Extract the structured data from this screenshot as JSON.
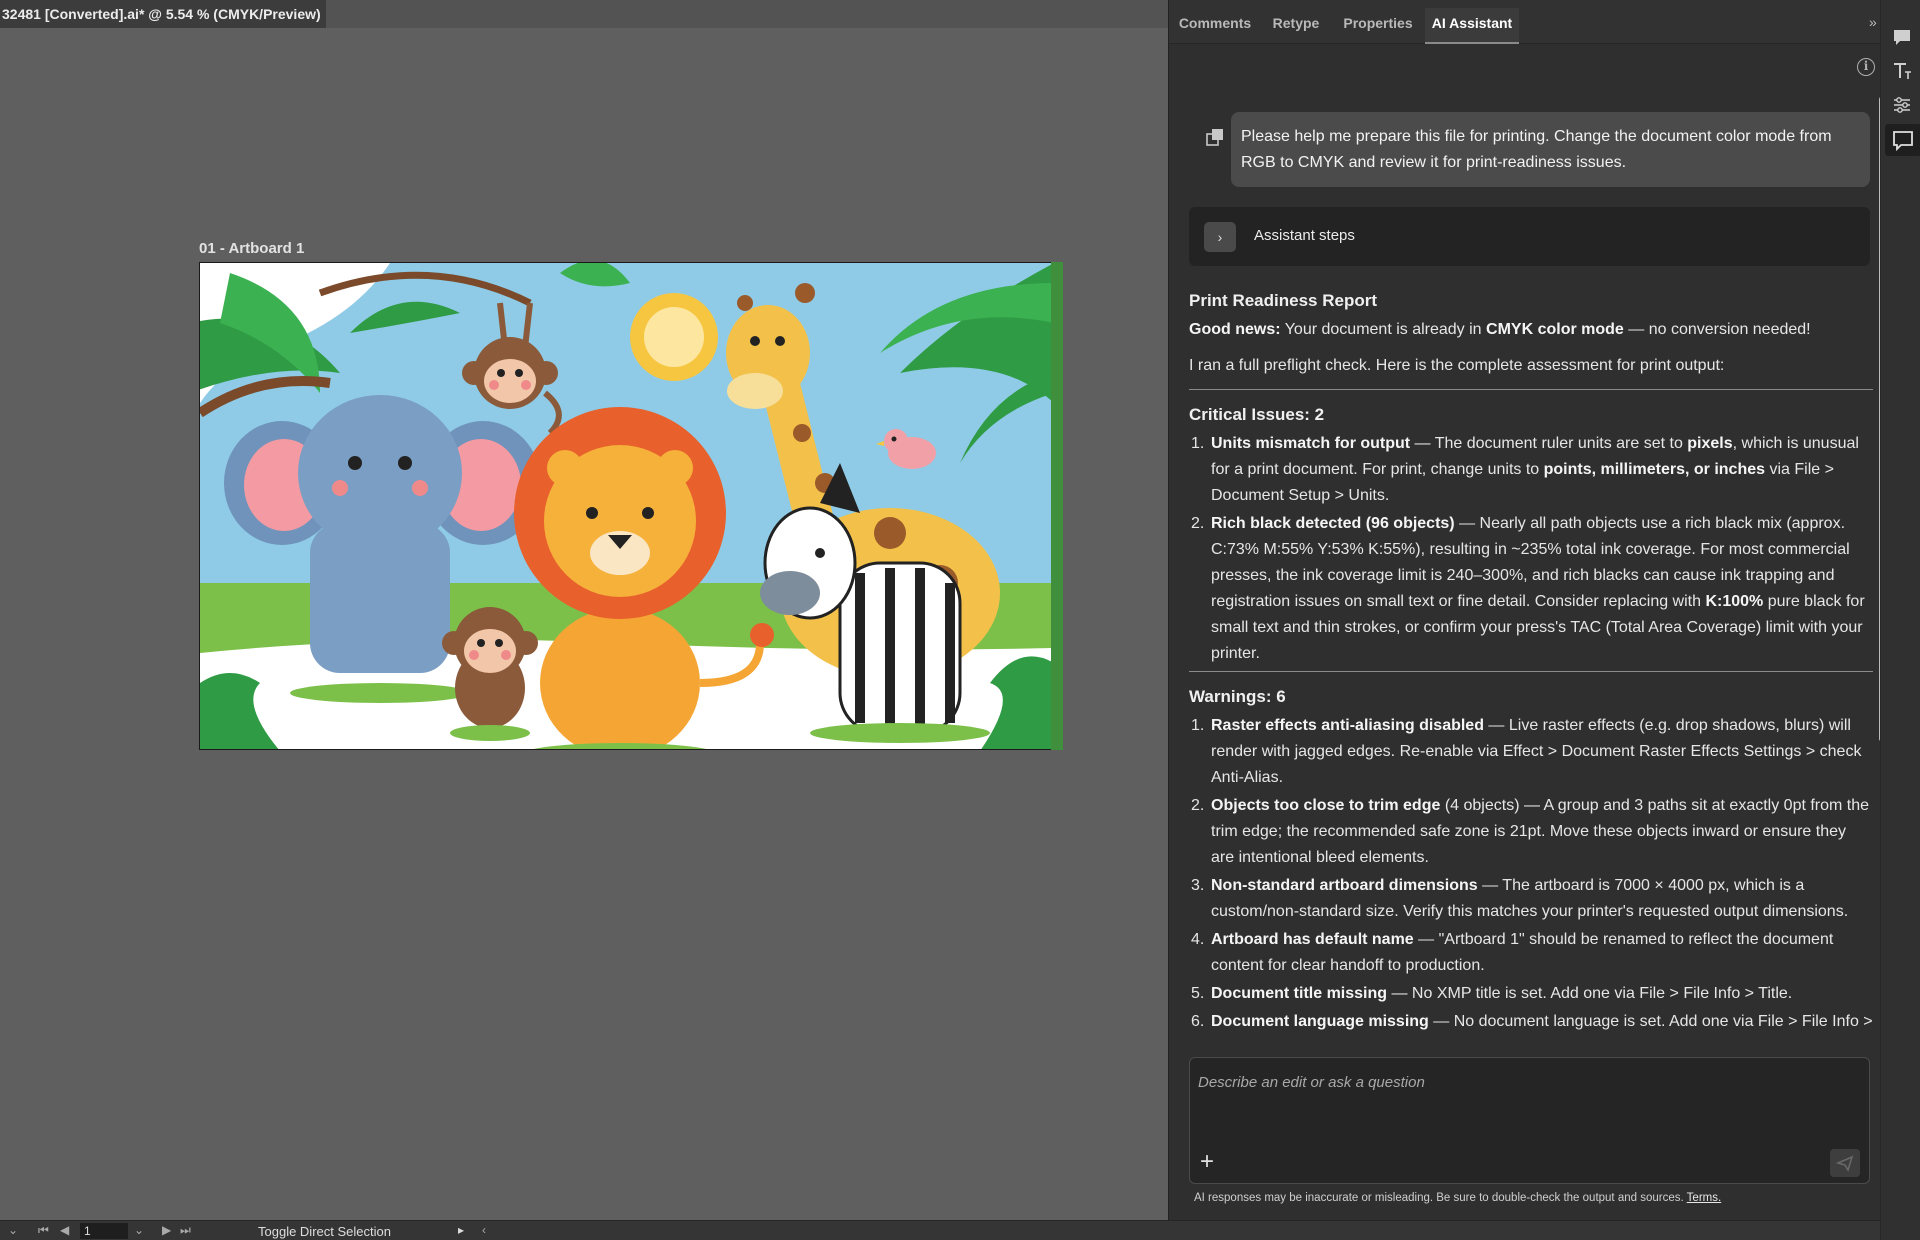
{
  "document": {
    "tab_title": "32481 [Converted].ai* @ 5.54 % (CMYK/Preview)"
  },
  "canvas": {
    "artboard_label": "01 - Artboard 1"
  },
  "panel": {
    "tabs": [
      {
        "label": "Comments"
      },
      {
        "label": "Retype"
      },
      {
        "label": "Properties"
      },
      {
        "label": "AI Assistant"
      }
    ],
    "active_tab": "AI Assistant",
    "user_message": "Please help me prepare this file for printing. Change the document color mode from RGB to CMYK and review it for print-readiness issues.",
    "assistant_steps_label": "Assistant steps",
    "report": {
      "title": "Print Readiness Report",
      "good_news_label": "Good news:",
      "good_news_text_1": " Your document is already in ",
      "good_news_bold": "CMYK color mode",
      "good_news_text_2": " — no conversion needed!",
      "intro": "I ran a full preflight check. Here is the complete assessment for print output:",
      "critical_heading": "Critical Issues: 2",
      "critical": [
        {
          "num": "1.",
          "title": "Units mismatch for output",
          "t1": " — The document ruler units are set to ",
          "b1": "pixels",
          "t2": ", which is unusual for a print document. For print, change units to ",
          "b2": "points, millimeters, or inches",
          "t3": " via File > Document Setup > Units."
        },
        {
          "num": "2.",
          "title": "Rich black detected (96 objects)",
          "t1": " — Nearly all path objects use a rich black mix (approx. C:73% M:55% Y:53% K:55%), resulting in ~235% total ink coverage. For most commercial presses, the ink coverage limit is 240–300%, and rich blacks can cause ink trapping and registration issues on small text or fine detail. Consider replacing with ",
          "b1": "K:100%",
          "t2": " pure black for small text and thin strokes, or confirm your press's TAC (Total Area Coverage) limit with your printer."
        }
      ],
      "warnings_heading": "Warnings: 6",
      "warnings": [
        {
          "num": "1.",
          "title": "Raster effects anti-aliasing disabled",
          "text": " — Live raster effects (e.g. drop shadows, blurs) will render with jagged edges. Re-enable via Effect > Document Raster Effects Settings > check Anti-Alias."
        },
        {
          "num": "2.",
          "title": "Objects too close to trim edge",
          "text": " (4 objects) — A group and 3 paths sit at exactly 0pt from the trim edge; the recommended safe zone is 21pt. Move these objects inward or ensure they are intentional bleed elements."
        },
        {
          "num": "3.",
          "title": "Non-standard artboard dimensions",
          "text": " — The artboard is 7000 × 4000 px, which is a custom/non-standard size. Verify this matches your printer's requested output dimensions."
        },
        {
          "num": "4.",
          "title": "Artboard has default name",
          "text": " — \"Artboard 1\" should be renamed to reflect the document content for clear handoff to production."
        },
        {
          "num": "5.",
          "title": "Document title missing",
          "text": " — No XMP title is set. Add one via File > File Info > Title."
        },
        {
          "num": "6.",
          "title": "Document language missing",
          "text": " — No document language is set. Add one via File > File Info >"
        }
      ]
    },
    "composer": {
      "placeholder": "Describe an edit or ask a question",
      "value": ""
    },
    "disclaimer": "AI responses may be inaccurate or misleading. Be sure to double-check the output and sources.",
    "terms_link": "Terms."
  },
  "statusbar": {
    "page_number": "1",
    "status_text": "Toggle Direct Selection"
  },
  "icons": {
    "info": "info-icon",
    "copy": "copy-icon",
    "chevron": "chevron-right-icon",
    "plus": "plus-icon",
    "send": "send-icon",
    "collapse": "double-chevron-right-icon"
  },
  "colors": {
    "panel_bg": "#2f2f2f",
    "canvas_bg": "#5f5f5f",
    "message_bg": "#4b4b4b"
  }
}
